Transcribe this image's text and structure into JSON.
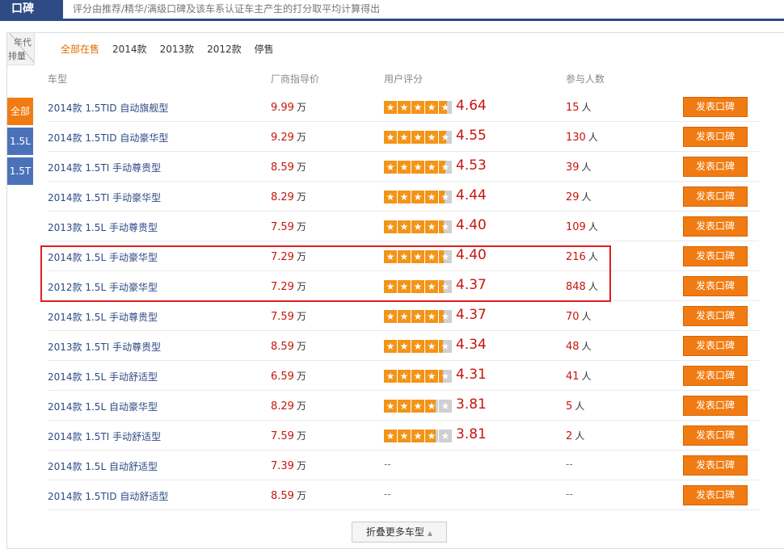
{
  "topbar": {
    "tab_label": "口碑",
    "description": "评分由推荐/精华/满级口碑及该车系认证车主产生的打分取平均计算得出"
  },
  "filter": {
    "corner_top": "年代",
    "corner_bottom": "排量",
    "year_tabs": [
      "全部在售",
      "2014款",
      "2013款",
      "2012款",
      "停售"
    ],
    "active_year_tab": "全部在售",
    "displacements": [
      "全部",
      "1.5L",
      "1.5T"
    ],
    "active_displacement": "全部"
  },
  "table": {
    "headers": {
      "model": "车型",
      "price": "厂商指导价",
      "rating": "用户评分",
      "count": "参与人数"
    },
    "price_unit": "万",
    "count_unit": "人",
    "button_label": "发表口碑",
    "empty_mark": "--",
    "rows": [
      {
        "model": "2014款 1.5TID 自动旗舰型",
        "price": "9.99",
        "score": "4.64",
        "count": "15"
      },
      {
        "model": "2014款 1.5TID 自动豪华型",
        "price": "9.29",
        "score": "4.55",
        "count": "130"
      },
      {
        "model": "2014款 1.5TI 手动尊贵型",
        "price": "8.59",
        "score": "4.53",
        "count": "39"
      },
      {
        "model": "2014款 1.5TI 手动豪华型",
        "price": "8.29",
        "score": "4.44",
        "count": "29"
      },
      {
        "model": "2013款 1.5L 手动尊贵型",
        "price": "7.59",
        "score": "4.40",
        "count": "109"
      },
      {
        "model": "2014款 1.5L 手动豪华型",
        "price": "7.29",
        "score": "4.40",
        "count": "216"
      },
      {
        "model": "2012款 1.5L 手动豪华型",
        "price": "7.29",
        "score": "4.37",
        "count": "848"
      },
      {
        "model": "2014款 1.5L 手动尊贵型",
        "price": "7.59",
        "score": "4.37",
        "count": "70"
      },
      {
        "model": "2013款 1.5TI 手动尊贵型",
        "price": "8.59",
        "score": "4.34",
        "count": "48"
      },
      {
        "model": "2014款 1.5L 手动舒适型",
        "price": "6.59",
        "score": "4.31",
        "count": "41"
      },
      {
        "model": "2014款 1.5L 自动豪华型",
        "price": "8.29",
        "score": "3.81",
        "count": "5"
      },
      {
        "model": "2014款 1.5TI 手动舒适型",
        "price": "7.59",
        "score": "3.81",
        "count": "2"
      },
      {
        "model": "2014款 1.5L 自动舒适型",
        "price": "7.39",
        "score": null,
        "count": null
      },
      {
        "model": "2014款 1.5TID 自动舒适型",
        "price": "8.59",
        "score": null,
        "count": null
      }
    ]
  },
  "fold_button_label": "折叠更多车型",
  "colors": {
    "accent": "#f07b12",
    "brand": "#2f4b86",
    "price": "#c8140c",
    "highlight": "#e01e1e"
  }
}
